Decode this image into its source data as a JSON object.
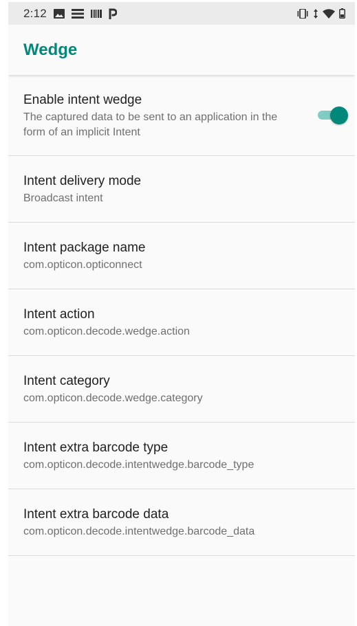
{
  "status_bar": {
    "time": "2:12",
    "left_icons": [
      "image-icon",
      "menu-lines-icon",
      "barcode-icon",
      "p-icon"
    ],
    "right_icons": [
      "vibrate-icon",
      "data-arrows-icon",
      "wifi-icon",
      "battery-icon"
    ]
  },
  "app_bar": {
    "title": "Wedge"
  },
  "accent_color": "#00897b",
  "preferences": [
    {
      "title": "Enable intent wedge",
      "summary": "The captured data to be sent to an application in the form of an implicit Intent",
      "toggle_on": true
    },
    {
      "title": "Intent delivery mode",
      "summary": "Broadcast intent"
    },
    {
      "title": "Intent package name",
      "summary": "com.opticon.opticonnect"
    },
    {
      "title": "Intent action",
      "summary": "com.opticon.decode.wedge.action"
    },
    {
      "title": "Intent category",
      "summary": "com.opticon.decode.wedge.category"
    },
    {
      "title": "Intent extra barcode type",
      "summary": "com.opticon.decode.intentwedge.barcode_type"
    },
    {
      "title": "Intent extra barcode data",
      "summary": "com.opticon.decode.intentwedge.barcode_data"
    }
  ]
}
